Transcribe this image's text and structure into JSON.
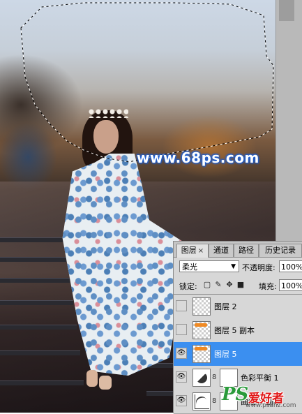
{
  "canvas": {
    "watermark": "www.68ps.com"
  },
  "layers_panel": {
    "tabs": [
      {
        "label": "图层",
        "close": "×",
        "active": true
      },
      {
        "label": "通道",
        "active": false
      },
      {
        "label": "路径",
        "active": false
      },
      {
        "label": "历史记录",
        "active": false
      }
    ],
    "blend_mode": "柔光",
    "opacity_label": "不透明度:",
    "opacity_value": "100%",
    "lock_label": "锁定:",
    "fill_label": "填充:",
    "fill_value": "100%",
    "layers": [
      {
        "name": "图层 2",
        "visible": false,
        "selected": false,
        "thumb": "transparent"
      },
      {
        "name": "图层 5 副本",
        "visible": false,
        "selected": false,
        "thumb": "orange"
      },
      {
        "name": "图层 5",
        "visible": true,
        "selected": true,
        "thumb": "orange"
      },
      {
        "name": "色彩平衡 1",
        "visible": true,
        "selected": false,
        "thumb": "adjustment"
      },
      {
        "name": "曲线 1 副本",
        "visible": true,
        "selected": false,
        "thumb": "curves"
      }
    ],
    "selected_color": "#3b8ff0"
  },
  "logo": {
    "ps": "PS",
    "cn": "爱好者",
    "url": "www.psahz.com"
  }
}
